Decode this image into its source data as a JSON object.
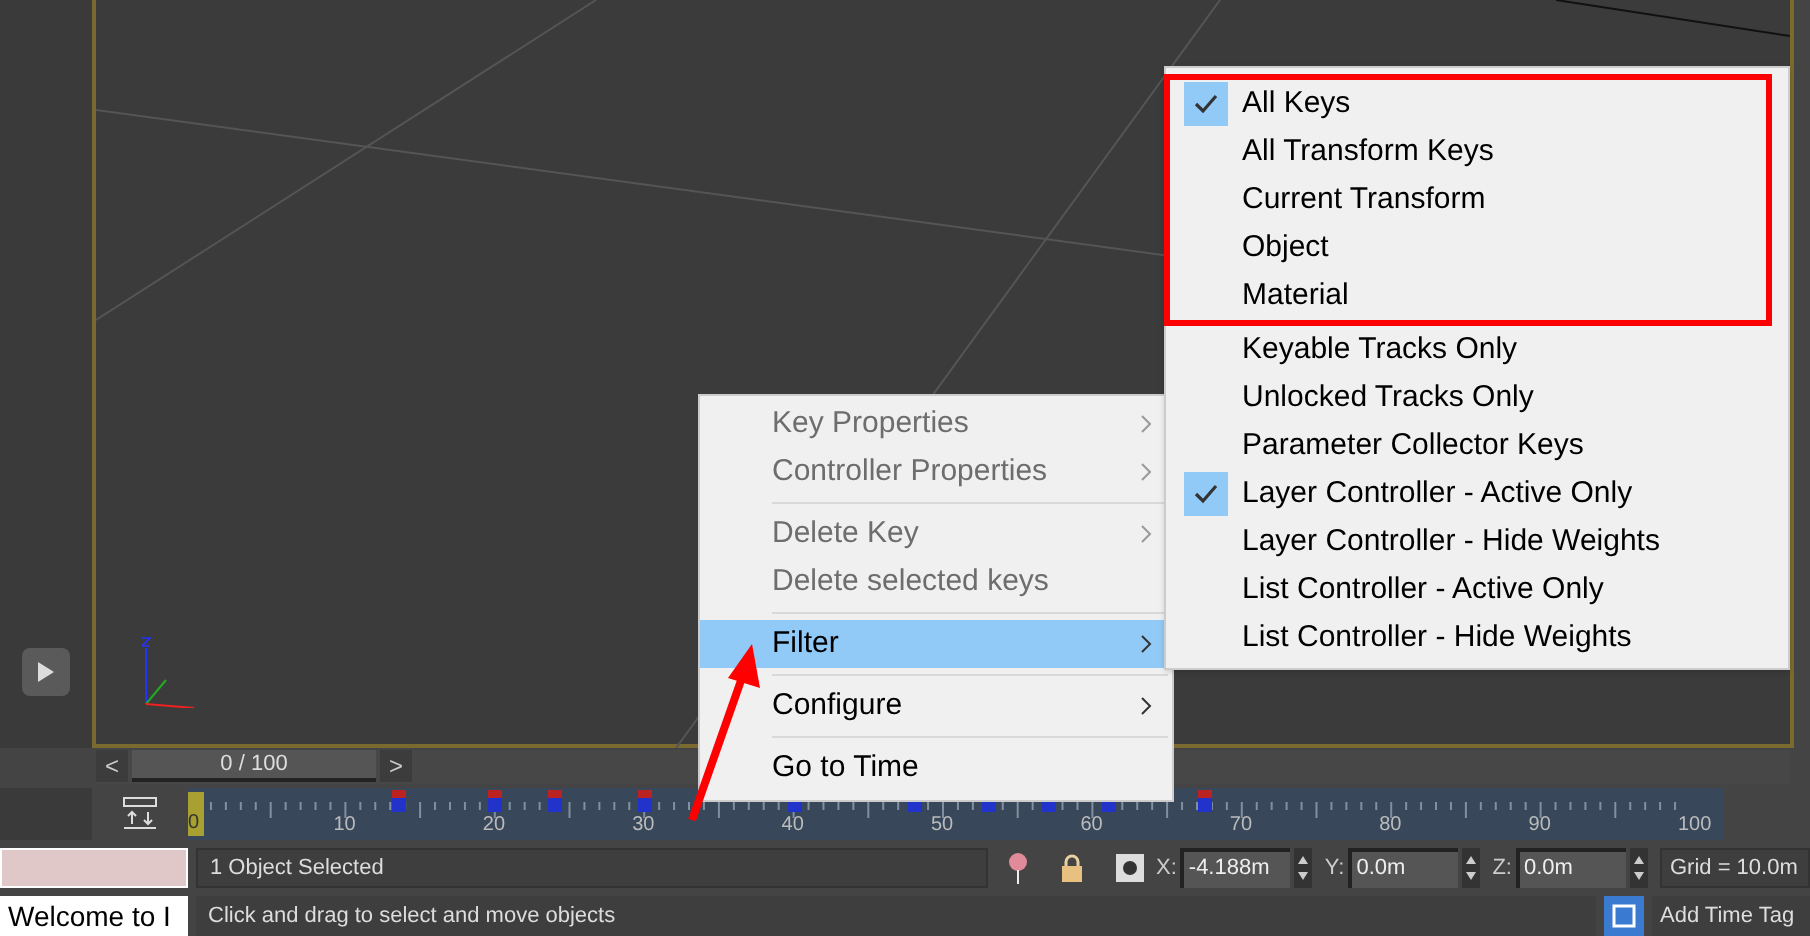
{
  "context_menu": {
    "groups": [
      {
        "items": [
          {
            "label": "Key Properties",
            "disabled": true,
            "submenu": true,
            "selected": false
          },
          {
            "label": "Controller Properties",
            "disabled": true,
            "submenu": true,
            "selected": false
          }
        ]
      },
      {
        "items": [
          {
            "label": "Delete Key",
            "disabled": true,
            "submenu": true,
            "selected": false
          },
          {
            "label": "Delete selected keys",
            "disabled": true,
            "submenu": false,
            "selected": false
          }
        ]
      },
      {
        "items": [
          {
            "label": "Filter",
            "disabled": false,
            "submenu": true,
            "selected": true
          }
        ]
      },
      {
        "items": [
          {
            "label": "Configure",
            "disabled": false,
            "submenu": true,
            "selected": false
          }
        ]
      },
      {
        "items": [
          {
            "label": "Go to Time",
            "disabled": false,
            "submenu": false,
            "selected": false
          }
        ]
      }
    ]
  },
  "filter_submenu": {
    "groups": [
      {
        "outlined": true,
        "items": [
          {
            "label": "All Keys",
            "checked": true
          },
          {
            "label": "All Transform Keys",
            "checked": false
          },
          {
            "label": "Current Transform",
            "checked": false
          },
          {
            "label": "Object",
            "checked": false
          },
          {
            "label": "Material",
            "checked": false
          }
        ]
      },
      {
        "outlined": false,
        "items": [
          {
            "label": "Keyable Tracks Only",
            "checked": false
          },
          {
            "label": "Unlocked Tracks Only",
            "checked": false
          },
          {
            "label": "Parameter Collector Keys",
            "checked": false
          },
          {
            "label": "Layer Controller - Active Only",
            "checked": true
          },
          {
            "label": "Layer Controller - Hide Weights",
            "checked": false
          },
          {
            "label": "List Controller - Active Only",
            "checked": false
          },
          {
            "label": "List Controller - Hide Weights",
            "checked": false
          }
        ]
      }
    ]
  },
  "time_slider": {
    "prev": "<",
    "frame": "0 / 100",
    "level": 0,
    "next": ">"
  },
  "track_bar": {
    "current_frame": "0",
    "labels": [
      "10",
      "20",
      "30",
      "40",
      "50",
      "60",
      "70",
      "80",
      "90",
      "100"
    ]
  },
  "status_bar": {
    "selection": "1 Object Selected",
    "coords": [
      {
        "label": "X:",
        "value": "-4.188m"
      },
      {
        "label": "Y:",
        "value": "0.0m"
      },
      {
        "label": "Z:",
        "value": "0.0m"
      }
    ],
    "grid": "Grid = 10.0m",
    "listener": "Welcome to I",
    "prompt": "Click and drag to select and move objects",
    "add_time_tag": "Add Time Tag"
  }
}
